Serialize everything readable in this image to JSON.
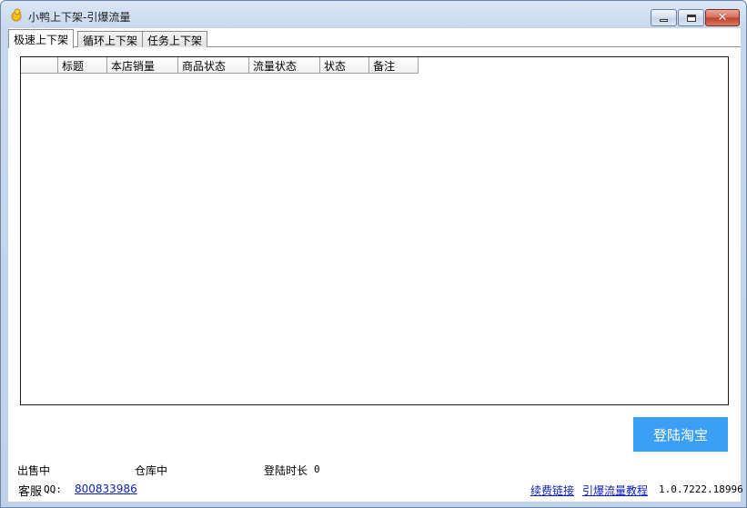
{
  "window": {
    "title": "小鸭上下架-引爆流量"
  },
  "tabs": [
    {
      "label": "极速上下架",
      "active": true
    },
    {
      "label": "循环上下架",
      "active": false
    },
    {
      "label": "任务上下架",
      "active": false
    }
  ],
  "grid": {
    "columns": [
      "",
      "标题",
      "本店销量",
      "商品状态",
      "流量状态",
      "状态",
      "备注"
    ],
    "rows": []
  },
  "login_button": "登陆淘宝",
  "status": {
    "on_sale": "出售中",
    "in_warehouse": "仓库中",
    "login_duration_label": "登陆时长",
    "login_duration_value": "0"
  },
  "footer": {
    "support_label": "客服",
    "qq_label": "QQ:",
    "qq_number": "800833986",
    "renew_link": "续费链接",
    "tutorial_link": "引爆流量教程",
    "version": "1.0.7222.18996"
  },
  "colors": {
    "accent_button": "#3b9ff5",
    "link": "#0a1fb8",
    "close_button": "#c0402a"
  }
}
